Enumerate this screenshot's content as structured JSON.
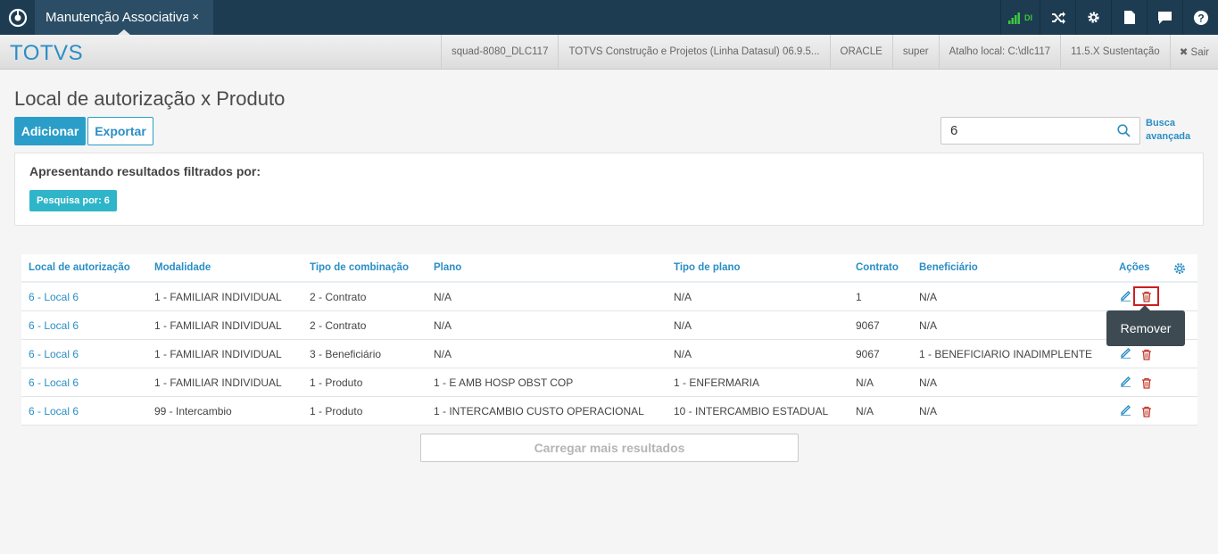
{
  "topbar": {
    "tab_title": "Manutenção Associativa",
    "tab_close": "×",
    "signal_label": "DI",
    "icons": [
      "logo-icon",
      "shuffle-icon",
      "gear-icon",
      "document-icon",
      "chat-icon",
      "help-icon"
    ]
  },
  "header": {
    "brand": "TOTVS",
    "items": [
      "squad-8080_DLC117",
      "TOTVS Construção e Projetos (Linha Datasul) 06.9.5...",
      "ORACLE",
      "super",
      "Atalho local: C:\\dlc117",
      "11.5.X Sustentação"
    ],
    "logout": "✖ Sair"
  },
  "page": {
    "title": "Local de autorização x Produto",
    "add_label": "Adicionar",
    "export_label": "Exportar",
    "search_value": "6",
    "advanced_search_line1": "Busca",
    "advanced_search_line2": "avançada"
  },
  "filter": {
    "title": "Apresentando resultados filtrados por:",
    "chip": "Pesquisa por: 6"
  },
  "table": {
    "headers": [
      "Local de autorização",
      "Modalidade",
      "Tipo de combinação",
      "Plano",
      "Tipo de plano",
      "Contrato",
      "Beneficiário",
      "Ações"
    ],
    "rows": [
      [
        "6 - Local 6",
        "1 - FAMILIAR INDIVIDUAL",
        "2 - Contrato",
        "N/A",
        "N/A",
        "1",
        "N/A"
      ],
      [
        "6 - Local 6",
        "1 - FAMILIAR INDIVIDUAL",
        "2 - Contrato",
        "N/A",
        "N/A",
        "9067",
        "N/A"
      ],
      [
        "6 - Local 6",
        "1 - FAMILIAR INDIVIDUAL",
        "3 - Beneficiário",
        "N/A",
        "N/A",
        "9067",
        "1 - BENEFICIARIO INADIMPLENTE"
      ],
      [
        "6 - Local 6",
        "1 - FAMILIAR INDIVIDUAL",
        "1 - Produto",
        "1 - E AMB HOSP OBST COP",
        "1 - ENFERMARIA",
        "N/A",
        "N/A"
      ],
      [
        "6 - Local 6",
        "99 - Intercambio",
        "1 - Produto",
        "1 - INTERCAMBIO CUSTO OPERACIONAL",
        "10 - INTERCAMBIO ESTADUAL",
        "N/A",
        "N/A"
      ]
    ]
  },
  "tooltip": "Remover",
  "load_more": "Carregar mais resultados",
  "colors": {
    "topbar": "#1d3c52",
    "accent": "#2a9ec8",
    "chip": "#2fb5c9",
    "delete": "#c0392b",
    "highlight": "#cc1f1f"
  }
}
